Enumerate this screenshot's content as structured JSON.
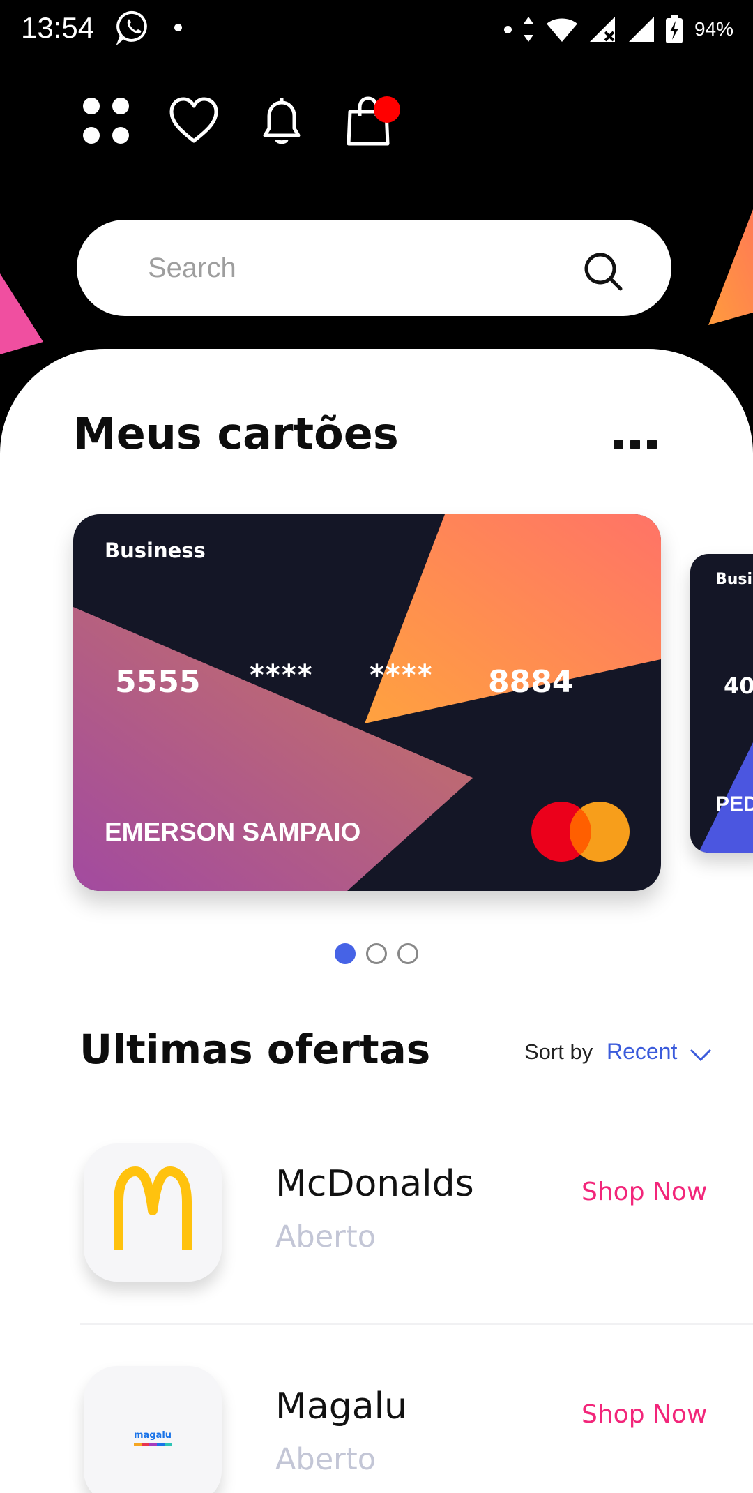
{
  "status_bar": {
    "time": "13:54",
    "battery": "94%",
    "icons": [
      "whatsapp-icon",
      "notification-dot",
      "data-arrows-icon",
      "wifi-icon",
      "signal-icon",
      "battery-icon"
    ]
  },
  "top_actions": [
    "grid-menu-icon",
    "heart-icon",
    "bell-icon",
    "shopping-bag-icon"
  ],
  "search": {
    "placeholder": "Search",
    "value": ""
  },
  "cards_section": {
    "title": "Meus cartões",
    "more_label": "...",
    "cards": [
      {
        "type": "Business",
        "number_groups": [
          "5555",
          "****",
          "****",
          "8884"
        ],
        "holder": "EMERSON SAMPAIO",
        "brand": "mastercard"
      },
      {
        "type": "Business",
        "number_groups": [
          "40"
        ],
        "holder": "PED"
      }
    ],
    "pager": {
      "count": 3,
      "active_index": 0
    }
  },
  "offers_section": {
    "title": "Ultimas ofertas",
    "sort_label": "Sort by",
    "sort_value": "Recent",
    "items": [
      {
        "name": "McDonalds",
        "status": "Aberto",
        "action": "Shop Now",
        "logo": "mcdonalds-logo"
      },
      {
        "name": "Magalu",
        "status": "Aberto",
        "action": "Shop Now",
        "logo": "magalu-logo",
        "logo_text": "magalu"
      }
    ]
  },
  "colors": {
    "accent_blue": "#3b5bdb",
    "shop_now_pink": "#f2267a",
    "badge_red": "#ff0000",
    "card_dark": "#141626"
  }
}
